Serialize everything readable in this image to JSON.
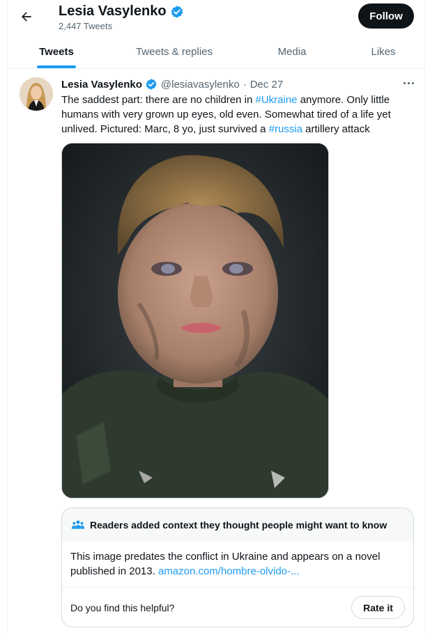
{
  "header": {
    "name": "Lesia Vasylenko",
    "tweet_count": "2,447 Tweets",
    "follow_label": "Follow"
  },
  "tabs": [
    {
      "label": "Tweets",
      "active": true
    },
    {
      "label": "Tweets & replies",
      "active": false
    },
    {
      "label": "Media",
      "active": false
    },
    {
      "label": "Likes",
      "active": false
    }
  ],
  "tweet": {
    "author": "Lesia Vasylenko",
    "handle": "@lesiavasylenko",
    "separator": "·",
    "date": "Dec 27",
    "text_1": "The saddest part: there are no children in ",
    "hashtag_1": "#Ukraine",
    "text_2": " anymore. Only little humans with very grown up eyes, old even. Somewhat tired of a life yet unlived. Pictured: Marc, 8 yo, just survived a ",
    "hashtag_2": "#russia",
    "text_3": " artillery attack"
  },
  "note": {
    "heading": "Readers added context they thought people might want to know",
    "body": "This image predates the conflict in Ukraine and appears on a novel published in 2013. ",
    "link": "amazon.com/hombre-olvido-...",
    "question": "Do you find this helpful?",
    "rate_label": "Rate it"
  },
  "colors": {
    "accent": "#1d9bf0",
    "text": "#0f1419",
    "muted": "#536471",
    "border": "#cfd9de"
  },
  "icons": {
    "back": "arrow-left-icon",
    "verified": "verified-badge-icon",
    "more": "more-horizontal-icon",
    "people": "people-icon"
  }
}
